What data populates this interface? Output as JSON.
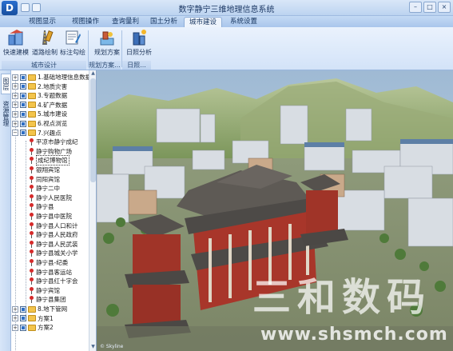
{
  "window": {
    "title": "数字静宁三维地理信息系统",
    "logo": "D",
    "minimize": "–",
    "maximize": "□",
    "close": "×"
  },
  "tabs": [
    {
      "label": "视图显示"
    },
    {
      "label": "视图操作"
    },
    {
      "label": "查询量利"
    },
    {
      "label": "国土分析"
    },
    {
      "label": "城市建设"
    },
    {
      "label": "系统设置"
    }
  ],
  "active_tab": "城市建设",
  "ribbon": {
    "buttons": [
      {
        "label": "快速建模",
        "icon": "modeling-tools-icon"
      },
      {
        "label": "道路绘制",
        "icon": "road-draw-icon"
      },
      {
        "label": "标注勾绘",
        "icon": "annotation-icon"
      },
      {
        "label": "规划方案",
        "icon": "planning-plan-icon"
      },
      {
        "label": "日照分析",
        "icon": "sunlight-analysis-icon"
      }
    ],
    "groups": [
      {
        "label": "城市设计"
      },
      {
        "label": "规划方案..."
      },
      {
        "label": "日照..."
      }
    ]
  },
  "side_tabs": [
    {
      "label": "图层"
    },
    {
      "label": "资源管理"
    }
  ],
  "tree": {
    "items": [
      {
        "label": "1.基础地理信息数据",
        "type": "folder"
      },
      {
        "label": "2.地质灾害",
        "type": "folder"
      },
      {
        "label": "3.专题数据",
        "type": "folder"
      },
      {
        "label": "4.矿产数据",
        "type": "folder"
      },
      {
        "label": "5.城市建设",
        "type": "folder"
      },
      {
        "label": "6.视点浏览",
        "type": "folder"
      },
      {
        "label": "7.兴趣点",
        "type": "folder-open"
      },
      {
        "label": "平凉市静宁成纪",
        "type": "poi"
      },
      {
        "label": "静宁购物广场",
        "type": "poi"
      },
      {
        "label": "成纪博物馆",
        "type": "poi",
        "selected": true
      },
      {
        "label": "银翔宾馆",
        "type": "poi"
      },
      {
        "label": "同阳宾馆",
        "type": "poi"
      },
      {
        "label": "静宁二中",
        "type": "poi"
      },
      {
        "label": "静宁人民医院",
        "type": "poi"
      },
      {
        "label": "静宁县",
        "type": "poi"
      },
      {
        "label": "静宁县中医院",
        "type": "poi"
      },
      {
        "label": "静宁县人口和计",
        "type": "poi"
      },
      {
        "label": "静宁县人民政府",
        "type": "poi"
      },
      {
        "label": "静宁县人民武装",
        "type": "poi"
      },
      {
        "label": "静宁县城关小学",
        "type": "poi"
      },
      {
        "label": "静宁县-纪委",
        "type": "poi"
      },
      {
        "label": "静宁县客运站",
        "type": "poi"
      },
      {
        "label": "静宁县红十字会",
        "type": "poi"
      },
      {
        "label": "静宁宾馆",
        "type": "poi"
      },
      {
        "label": "静宁县集团",
        "type": "poi"
      },
      {
        "label": "8.地下管网",
        "type": "folder"
      },
      {
        "label": "方案1",
        "type": "folder"
      },
      {
        "label": "方案2",
        "type": "folder"
      }
    ]
  },
  "viewport": {
    "engine_label": "© Skyline",
    "watermark_cn": "三和数码",
    "watermark_url": "www.shsmch.com"
  }
}
